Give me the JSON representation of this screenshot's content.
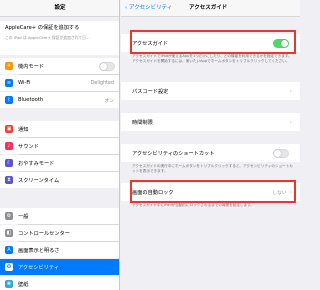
{
  "sidebar": {
    "title": "設定",
    "applecare_label": "AppleCare+ の保証を追加する",
    "applecare_note": "この iPad は AppleCare+ 保証が追加されて日...",
    "items": [
      {
        "label": "機内モード",
        "icon": "airplane-icon",
        "color": "#ff9500",
        "glyph": "✈"
      },
      {
        "label": "Wi-Fi",
        "value": "Delighted",
        "icon": "wifi-icon",
        "color": "#007aff",
        "glyph": "≋"
      },
      {
        "label": "Bluetooth",
        "value": "オン",
        "icon": "bluetooth-icon",
        "color": "#007aff",
        "glyph": "ᛒ"
      },
      {
        "label": "通知",
        "icon": "notifications-icon",
        "color": "#ff3b30",
        "glyph": "▣"
      },
      {
        "label": "サウンド",
        "icon": "sound-icon",
        "color": "#ff2d55",
        "glyph": "♪"
      },
      {
        "label": "おやすみモード",
        "icon": "moon-icon",
        "color": "#5856d6",
        "glyph": "☾"
      },
      {
        "label": "スクリーンタイム",
        "icon": "hourglass-icon",
        "color": "#5856d6",
        "glyph": "⧗"
      },
      {
        "label": "一般",
        "icon": "gear-icon",
        "color": "#8e8e93",
        "glyph": "⚙"
      },
      {
        "label": "コントロールセンター",
        "icon": "control-center-icon",
        "color": "#8e8e93",
        "glyph": "◧"
      },
      {
        "label": "画面表示と明るさ",
        "icon": "display-icon",
        "color": "#007aff",
        "glyph": "A"
      },
      {
        "label": "アクセシビリティ",
        "icon": "accessibility-icon",
        "color": "#007aff",
        "glyph": "✪"
      },
      {
        "label": "壁紙",
        "icon": "wallpaper-icon",
        "color": "#34aadc",
        "glyph": "❀"
      }
    ]
  },
  "detail": {
    "back_label": "アクセシビリティ",
    "title": "アクセスガイド",
    "guided_access_label": "アクセスガイド",
    "guided_access_on": true,
    "guided_access_note": "アクセスガイドでiPadが使えるAppを1つだけにしたり、どの機能を利用できるかを指定できます。アクセスガイドを開始するには、使いたいAppでホームボタンをトリプルクリックしてください。",
    "passcode_label": "パスコード設定",
    "time_limit_label": "時間制限",
    "shortcut_label": "アクセシビリティのショートカット",
    "shortcut_note": "アクセスガイドの実行中にホームボタンをトリプルクリックすると、アクセシビリティのショートカットを表示できます。",
    "autolock_label": "画面の自動ロック",
    "autolock_value": "しない",
    "autolock_note": "アクセスガイド中にiPadが自動的にロックされるまでの時間を設定します。"
  },
  "colors": {
    "highlight": "#e8372c",
    "toggle_on": "#4cd964",
    "accent": "#007aff"
  }
}
